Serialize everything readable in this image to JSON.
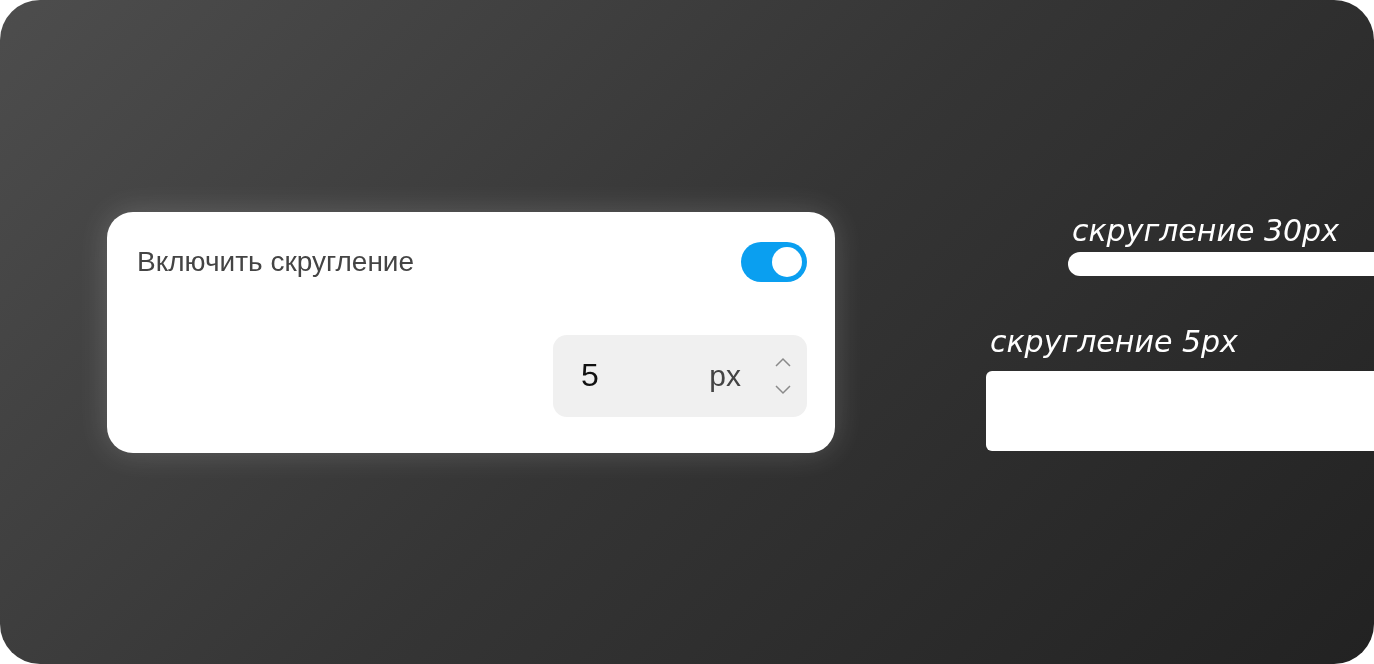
{
  "setting": {
    "label": "Включить скругление",
    "on": true,
    "value": "5",
    "unit": "px"
  },
  "examples": [
    {
      "label": "скругление 30px",
      "kind": "pill"
    },
    {
      "label": "скругление 5px",
      "kind": "box"
    }
  ]
}
